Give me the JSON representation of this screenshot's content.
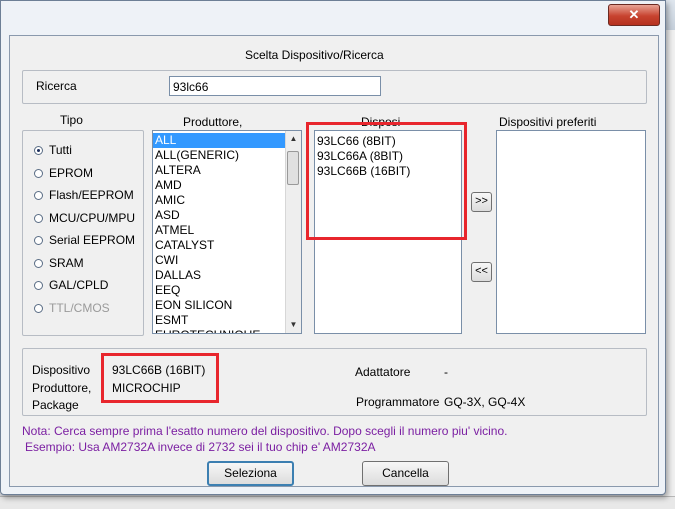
{
  "dialog": {
    "title": "Scelta Dispositivo/Ricerca",
    "close_label": "✕"
  },
  "search": {
    "label": "Ricerca",
    "value": "93lc66"
  },
  "type_group": {
    "title": "Tipo",
    "options": [
      {
        "label": "Tutti",
        "selected": true,
        "enabled": true
      },
      {
        "label": "EPROM",
        "selected": false,
        "enabled": true
      },
      {
        "label": "Flash/EEPROM",
        "selected": false,
        "enabled": true
      },
      {
        "label": "MCU/CPU/MPU",
        "selected": false,
        "enabled": true
      },
      {
        "label": "Serial EEPROM",
        "selected": false,
        "enabled": true
      },
      {
        "label": "SRAM",
        "selected": false,
        "enabled": true
      },
      {
        "label": "GAL/CPLD",
        "selected": false,
        "enabled": true
      },
      {
        "label": "TTL/CMOS",
        "selected": false,
        "enabled": false
      }
    ]
  },
  "manufacturers": {
    "title": "Produttore,",
    "items": [
      "ALL",
      "ALL(GENERIC)",
      "ALTERA",
      "AMD",
      "AMIC",
      "ASD",
      "ATMEL",
      "CATALYST",
      "CWI",
      "DALLAS",
      "EEQ",
      "EON SILICON",
      "ESMT",
      "EUROTECHNIQUE"
    ],
    "selected_index": 0
  },
  "devices": {
    "title": "Disposi",
    "items": [
      "93LC66 (8BIT)",
      "93LC66A (8BIT)",
      "93LC66B (16BIT)"
    ]
  },
  "favorites": {
    "title": "Dispositivi preferiti",
    "items": []
  },
  "buttons": {
    "add": ">>",
    "remove": "<<",
    "select": "Seleziona",
    "cancel": "Cancella"
  },
  "info": {
    "device_label": "Dispositivo",
    "device_value": "93LC66B (16BIT)",
    "manufacturer_label": "Produttore,",
    "manufacturer_value": "MICROCHIP",
    "package_label": "Package",
    "package_value": "-",
    "adapter_label": "Adattatore",
    "adapter_value": "-",
    "programmer_label": "Programmatore",
    "programmer_value": "GQ-3X, GQ-4X"
  },
  "notes": {
    "line1": "Nota: Cerca sempre prima l'esatto numero del dispositivo. Dopo scegli il numero piu' vicino.",
    "line2": "Esempio: Usa AM2732A invece di 2732 sei il tuo chip e' AM2732A"
  },
  "colors": {
    "highlight": "#e8262d",
    "note_text": "#7b1fa2",
    "selection": "#3399ff"
  }
}
